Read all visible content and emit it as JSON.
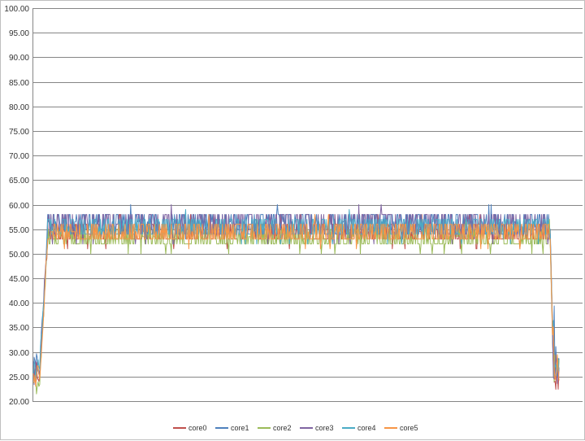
{
  "chart_data": {
    "type": "line",
    "title": "",
    "xlabel": "",
    "ylabel": "",
    "ylim": [
      20,
      100
    ],
    "y_ticks": [
      "20.00",
      "25.00",
      "30.00",
      "35.00",
      "40.00",
      "45.00",
      "50.00",
      "55.00",
      "60.00",
      "65.00",
      "70.00",
      "75.00",
      "80.00",
      "85.00",
      "90.00",
      "95.00",
      "100.00"
    ],
    "grid": "horizontal",
    "legend_position": "bottom",
    "n_points": 660,
    "profile_note_x": "x is sample index 0..659 (no x tick labels printed)",
    "series": [
      {
        "name": "core0",
        "color": "#C0504D",
        "idle_start": 26,
        "load_low": 53,
        "load_high": 56,
        "idle_end": 25
      },
      {
        "name": "core1",
        "color": "#4F81BD",
        "idle_start": 27,
        "load_low": 55,
        "load_high": 58,
        "idle_end": 28
      },
      {
        "name": "core2",
        "color": "#9BBB59",
        "idle_start": 24,
        "load_low": 52,
        "load_high": 55,
        "idle_end": 26
      },
      {
        "name": "core3",
        "color": "#8064A2",
        "idle_start": 26,
        "load_low": 54,
        "load_high": 58,
        "idle_end": 27
      },
      {
        "name": "core4",
        "color": "#4BACC6",
        "idle_start": 27,
        "load_low": 54,
        "load_high": 57,
        "idle_end": 28
      },
      {
        "name": "core5",
        "color": "#F79646",
        "idle_start": 25,
        "load_low": 53,
        "load_high": 56,
        "idle_end": 27
      }
    ]
  }
}
